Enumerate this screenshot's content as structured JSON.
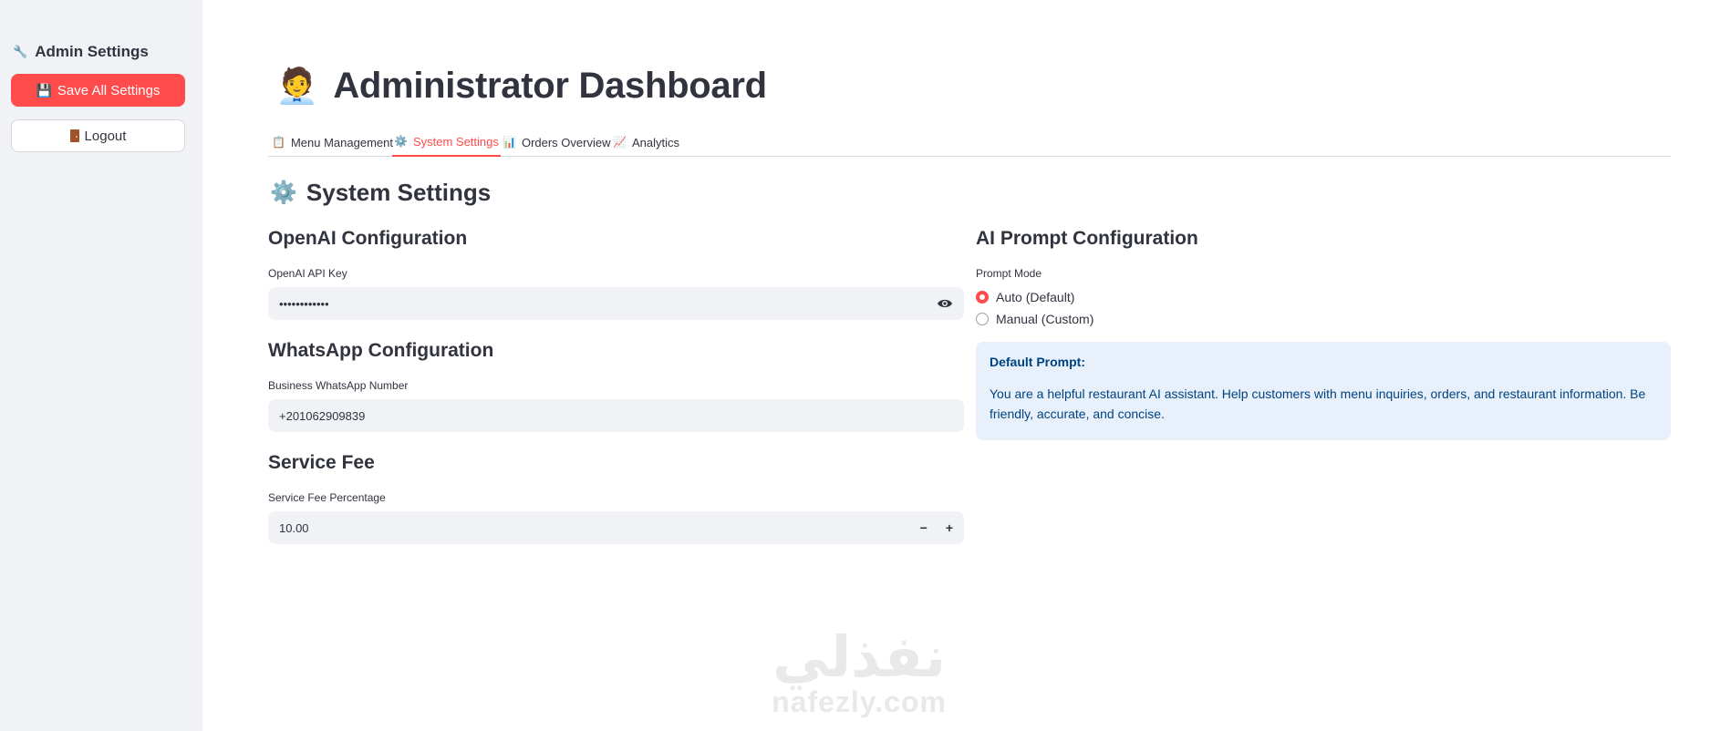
{
  "sidebar": {
    "header": "Admin Settings",
    "save_button": "Save All Settings",
    "logout_button": "Logout"
  },
  "header": {
    "title": "Administrator Dashboard"
  },
  "tabs": [
    {
      "label": "Menu Management",
      "active": false
    },
    {
      "label": "System Settings",
      "active": true
    },
    {
      "label": "Orders Overview",
      "active": false
    },
    {
      "label": "Analytics",
      "active": false
    }
  ],
  "section": {
    "title": "System Settings"
  },
  "openai": {
    "heading": "OpenAI Configuration",
    "api_key_label": "OpenAI API Key",
    "api_key_value": "••••••••••••"
  },
  "whatsapp": {
    "heading": "WhatsApp Configuration",
    "number_label": "Business WhatsApp Number",
    "number_value": "+201062909839"
  },
  "service_fee": {
    "heading": "Service Fee",
    "label": "Service Fee Percentage",
    "value": "10.00",
    "minus": "−",
    "plus": "+"
  },
  "prompt": {
    "heading": "AI Prompt Configuration",
    "mode_label": "Prompt Mode",
    "options": [
      {
        "label": "Auto (Default)",
        "selected": true
      },
      {
        "label": "Manual (Custom)",
        "selected": false
      }
    ],
    "default_title": "Default Prompt:",
    "default_text": "You are a helpful restaurant AI assistant. Help customers with menu inquiries, orders, and restaurant information. Be friendly, accurate, and concise."
  },
  "watermark": {
    "arabic": "نفذلي",
    "latin": "nafezly.com"
  },
  "colors": {
    "accent": "#ff4b4b",
    "sidebar_bg": "#f0f2f6",
    "info_bg": "#e8f1fb",
    "info_text": "#004280"
  }
}
